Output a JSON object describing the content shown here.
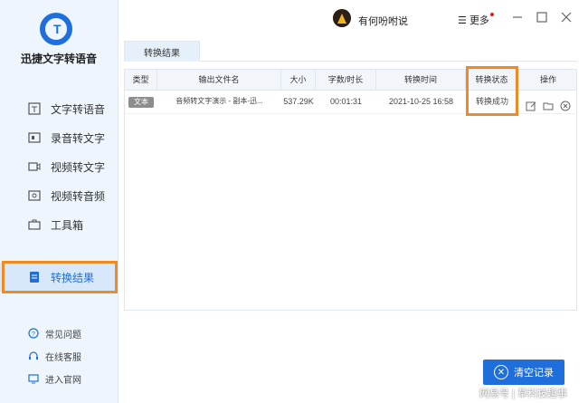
{
  "app": {
    "name": "迅捷文字转语音"
  },
  "nav": {
    "items": [
      {
        "label": "文字转语音",
        "icon": "text-to-speech-icon"
      },
      {
        "label": "录音转文字",
        "icon": "recording-icon"
      },
      {
        "label": "视频转文字",
        "icon": "video-text-icon"
      },
      {
        "label": "视频转音频",
        "icon": "video-audio-icon"
      },
      {
        "label": "工具箱",
        "icon": "toolbox-icon"
      },
      {
        "label": "转换结果",
        "icon": "result-icon",
        "active": true
      }
    ]
  },
  "help": {
    "items": [
      {
        "label": "常见问题",
        "icon": "question-icon"
      },
      {
        "label": "在线客服",
        "icon": "headset-icon"
      },
      {
        "label": "进入官网",
        "icon": "monitor-icon"
      }
    ]
  },
  "header": {
    "username": "有何吩咐说",
    "more_label": "更多"
  },
  "tabs": [
    {
      "label": "转换结果"
    }
  ],
  "table": {
    "headers": [
      "类型",
      "输出文件名",
      "大小",
      "字数/时长",
      "转换时间",
      "转换状态",
      "操作"
    ],
    "rows": [
      {
        "type": "文本",
        "filename": "音频转文字演示 - 副本-迅...",
        "size": "537.29K",
        "duration": "00:01:31",
        "time": "2021-10-25 16:58",
        "status": "转换成功"
      }
    ]
  },
  "clear_button": {
    "label": "清空记录"
  },
  "watermark": "网易号 | 草科技趣事",
  "colors": {
    "accent": "#1e6fdc",
    "highlight": "#f08a24",
    "sidebar_bg": "#eef5fd"
  }
}
